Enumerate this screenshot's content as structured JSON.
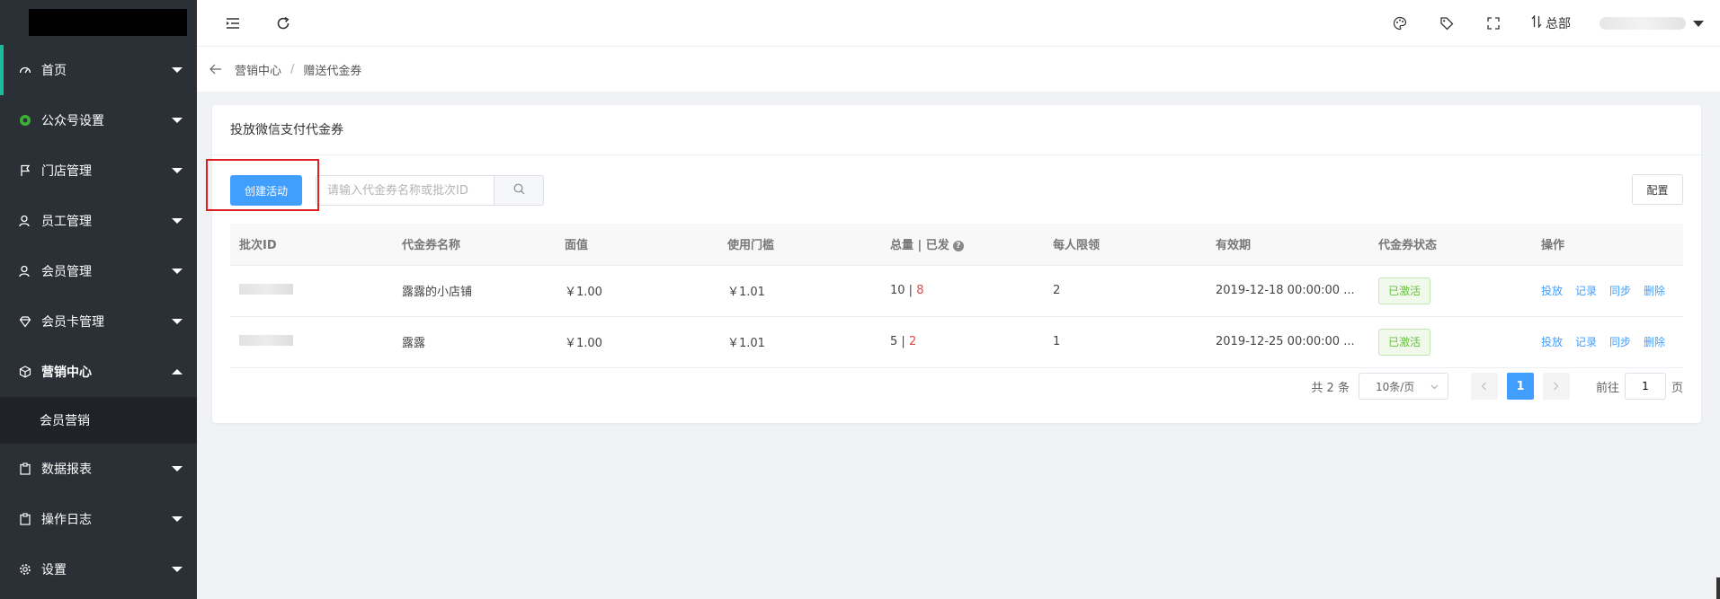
{
  "sidebar": {
    "items": [
      {
        "label": "首页",
        "icon": "dashboard-icon"
      },
      {
        "label": "公众号设置",
        "icon": "wechat-icon"
      },
      {
        "label": "门店管理",
        "icon": "flag-icon"
      },
      {
        "label": "员工管理",
        "icon": "user-icon"
      },
      {
        "label": "会员管理",
        "icon": "member-icon"
      },
      {
        "label": "会员卡管理",
        "icon": "diamond-icon"
      },
      {
        "label": "营销中心",
        "icon": "cube-icon"
      },
      {
        "label": "数据报表",
        "icon": "report-icon"
      },
      {
        "label": "操作日志",
        "icon": "log-icon"
      },
      {
        "label": "设置",
        "icon": "gear-icon"
      }
    ],
    "submenu": {
      "label": "会员营销"
    }
  },
  "topbar": {
    "branch_label": "总部"
  },
  "breadcrumb": {
    "parent": "营销中心",
    "separator": "/",
    "current": "赠送代金券"
  },
  "card": {
    "title": "投放微信支付代金券",
    "create_button": "创建活动",
    "search_placeholder": "请输入代金券名称或批次ID",
    "config_button": "配置"
  },
  "table": {
    "columns": [
      "批次ID",
      "代金券名称",
      "面值",
      "使用门槛",
      "总量 | 已发",
      "每人限领",
      "有效期",
      "代金券状态",
      "操作"
    ],
    "rows": [
      {
        "name": "露露的小店铺",
        "face_value": "￥1.00",
        "threshold": "￥1.01",
        "total": "10",
        "divider": " | ",
        "issued": "8",
        "limit": "2",
        "validity": "2019-12-18 00:00:00 ...",
        "status": "已激活"
      },
      {
        "name": "露露",
        "face_value": "￥1.00",
        "threshold": "￥1.01",
        "total": "5",
        "divider": " | ",
        "issued": "2",
        "limit": "1",
        "validity": "2019-12-25 00:00:00 ...",
        "status": "已激活"
      }
    ],
    "actions": [
      "投放",
      "记录",
      "同步",
      "删除"
    ]
  },
  "pagination": {
    "total_text": "共 2 条",
    "page_size": "10条/页",
    "current_page": "1",
    "goto_prefix": "前往",
    "goto_value": "1",
    "goto_suffix": "页"
  },
  "colors": {
    "primary": "#409eff",
    "sidebar_bg": "#2b3037",
    "active_bar": "#1abc9c",
    "issued_red": "#e84545",
    "status_green": "#67c23a"
  }
}
